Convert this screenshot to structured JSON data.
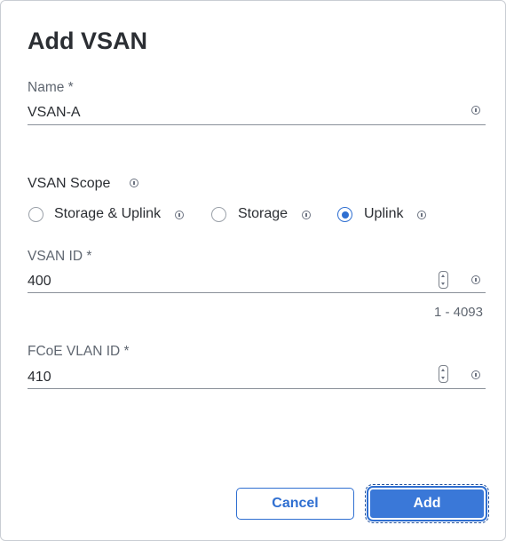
{
  "dialog": {
    "title": "Add VSAN"
  },
  "name_field": {
    "label": "Name *",
    "value": "VSAN-A"
  },
  "scope": {
    "label": "VSAN Scope",
    "options": [
      {
        "label": "Storage & Uplink",
        "selected": false
      },
      {
        "label": "Storage",
        "selected": false
      },
      {
        "label": "Uplink",
        "selected": true
      }
    ]
  },
  "vsan_id_field": {
    "label": "VSAN ID *",
    "value": "400",
    "range_hint": "1 - 4093"
  },
  "fcoe_vlan_id_field": {
    "label": "FCoE VLAN ID *",
    "value": "410"
  },
  "actions": {
    "cancel_label": "Cancel",
    "add_label": "Add"
  },
  "colors": {
    "accent": "#2f6fd1",
    "primary_button": "#3a78d8",
    "text": "#2b2e33",
    "muted_text": "#5f6670"
  },
  "icons": [
    "info-icon",
    "stepper-icon"
  ]
}
